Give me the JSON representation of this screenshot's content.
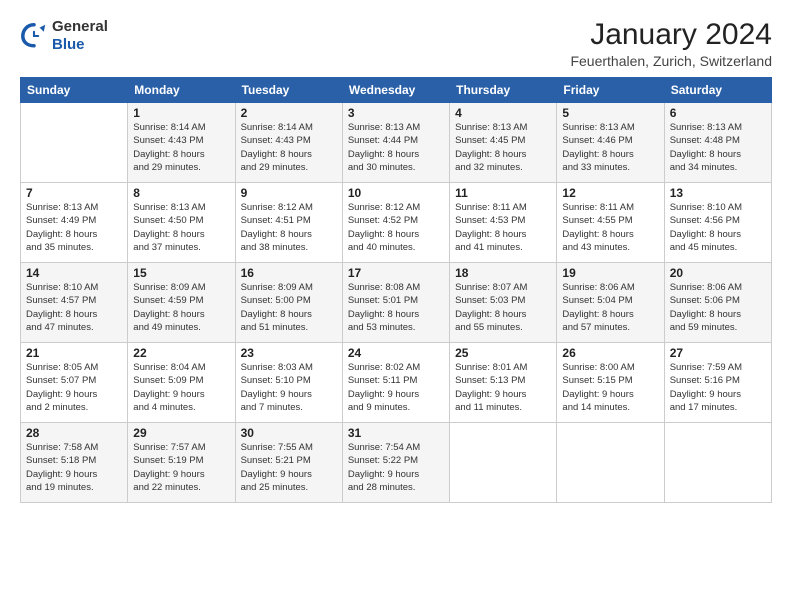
{
  "logo": {
    "general": "General",
    "blue": "Blue"
  },
  "title": "January 2024",
  "subtitle": "Feuerthalen, Zurich, Switzerland",
  "days_of_week": [
    "Sunday",
    "Monday",
    "Tuesday",
    "Wednesday",
    "Thursday",
    "Friday",
    "Saturday"
  ],
  "weeks": [
    [
      {
        "day": "",
        "info": ""
      },
      {
        "day": "1",
        "info": "Sunrise: 8:14 AM\nSunset: 4:43 PM\nDaylight: 8 hours\nand 29 minutes."
      },
      {
        "day": "2",
        "info": "Sunrise: 8:14 AM\nSunset: 4:43 PM\nDaylight: 8 hours\nand 29 minutes."
      },
      {
        "day": "3",
        "info": "Sunrise: 8:13 AM\nSunset: 4:44 PM\nDaylight: 8 hours\nand 30 minutes."
      },
      {
        "day": "4",
        "info": "Sunrise: 8:13 AM\nSunset: 4:45 PM\nDaylight: 8 hours\nand 32 minutes."
      },
      {
        "day": "5",
        "info": "Sunrise: 8:13 AM\nSunset: 4:46 PM\nDaylight: 8 hours\nand 33 minutes."
      },
      {
        "day": "6",
        "info": "Sunrise: 8:13 AM\nSunset: 4:48 PM\nDaylight: 8 hours\nand 34 minutes."
      }
    ],
    [
      {
        "day": "7",
        "info": "Sunrise: 8:13 AM\nSunset: 4:49 PM\nDaylight: 8 hours\nand 35 minutes."
      },
      {
        "day": "8",
        "info": "Sunrise: 8:13 AM\nSunset: 4:50 PM\nDaylight: 8 hours\nand 37 minutes."
      },
      {
        "day": "9",
        "info": "Sunrise: 8:12 AM\nSunset: 4:51 PM\nDaylight: 8 hours\nand 38 minutes."
      },
      {
        "day": "10",
        "info": "Sunrise: 8:12 AM\nSunset: 4:52 PM\nDaylight: 8 hours\nand 40 minutes."
      },
      {
        "day": "11",
        "info": "Sunrise: 8:11 AM\nSunset: 4:53 PM\nDaylight: 8 hours\nand 41 minutes."
      },
      {
        "day": "12",
        "info": "Sunrise: 8:11 AM\nSunset: 4:55 PM\nDaylight: 8 hours\nand 43 minutes."
      },
      {
        "day": "13",
        "info": "Sunrise: 8:10 AM\nSunset: 4:56 PM\nDaylight: 8 hours\nand 45 minutes."
      }
    ],
    [
      {
        "day": "14",
        "info": "Sunrise: 8:10 AM\nSunset: 4:57 PM\nDaylight: 8 hours\nand 47 minutes."
      },
      {
        "day": "15",
        "info": "Sunrise: 8:09 AM\nSunset: 4:59 PM\nDaylight: 8 hours\nand 49 minutes."
      },
      {
        "day": "16",
        "info": "Sunrise: 8:09 AM\nSunset: 5:00 PM\nDaylight: 8 hours\nand 51 minutes."
      },
      {
        "day": "17",
        "info": "Sunrise: 8:08 AM\nSunset: 5:01 PM\nDaylight: 8 hours\nand 53 minutes."
      },
      {
        "day": "18",
        "info": "Sunrise: 8:07 AM\nSunset: 5:03 PM\nDaylight: 8 hours\nand 55 minutes."
      },
      {
        "day": "19",
        "info": "Sunrise: 8:06 AM\nSunset: 5:04 PM\nDaylight: 8 hours\nand 57 minutes."
      },
      {
        "day": "20",
        "info": "Sunrise: 8:06 AM\nSunset: 5:06 PM\nDaylight: 8 hours\nand 59 minutes."
      }
    ],
    [
      {
        "day": "21",
        "info": "Sunrise: 8:05 AM\nSunset: 5:07 PM\nDaylight: 9 hours\nand 2 minutes."
      },
      {
        "day": "22",
        "info": "Sunrise: 8:04 AM\nSunset: 5:09 PM\nDaylight: 9 hours\nand 4 minutes."
      },
      {
        "day": "23",
        "info": "Sunrise: 8:03 AM\nSunset: 5:10 PM\nDaylight: 9 hours\nand 7 minutes."
      },
      {
        "day": "24",
        "info": "Sunrise: 8:02 AM\nSunset: 5:11 PM\nDaylight: 9 hours\nand 9 minutes."
      },
      {
        "day": "25",
        "info": "Sunrise: 8:01 AM\nSunset: 5:13 PM\nDaylight: 9 hours\nand 11 minutes."
      },
      {
        "day": "26",
        "info": "Sunrise: 8:00 AM\nSunset: 5:15 PM\nDaylight: 9 hours\nand 14 minutes."
      },
      {
        "day": "27",
        "info": "Sunrise: 7:59 AM\nSunset: 5:16 PM\nDaylight: 9 hours\nand 17 minutes."
      }
    ],
    [
      {
        "day": "28",
        "info": "Sunrise: 7:58 AM\nSunset: 5:18 PM\nDaylight: 9 hours\nand 19 minutes."
      },
      {
        "day": "29",
        "info": "Sunrise: 7:57 AM\nSunset: 5:19 PM\nDaylight: 9 hours\nand 22 minutes."
      },
      {
        "day": "30",
        "info": "Sunrise: 7:55 AM\nSunset: 5:21 PM\nDaylight: 9 hours\nand 25 minutes."
      },
      {
        "day": "31",
        "info": "Sunrise: 7:54 AM\nSunset: 5:22 PM\nDaylight: 9 hours\nand 28 minutes."
      },
      {
        "day": "",
        "info": ""
      },
      {
        "day": "",
        "info": ""
      },
      {
        "day": "",
        "info": ""
      }
    ]
  ]
}
